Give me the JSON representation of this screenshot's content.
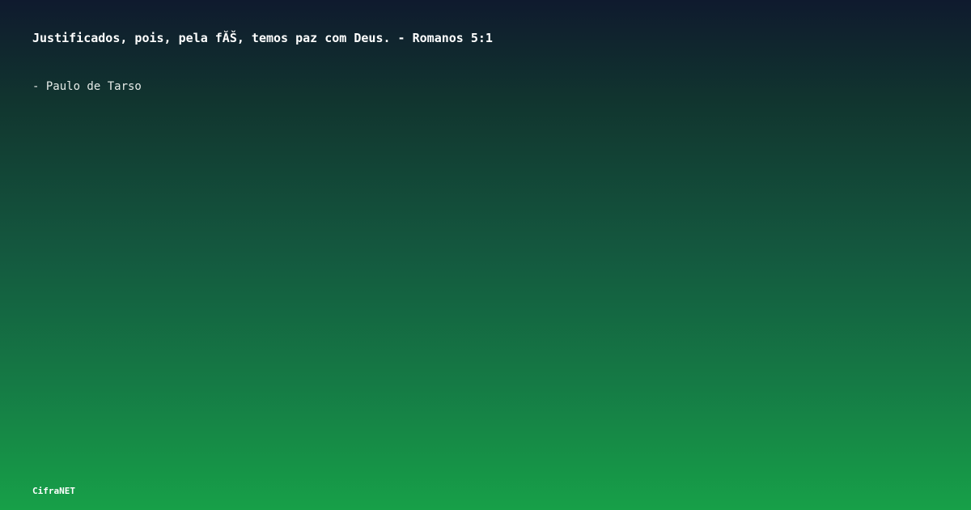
{
  "quote": {
    "text": "Justificados, pois, pela fĂŠ, temos paz com Deus. - Romanos 5:1"
  },
  "author": {
    "text": "- Paulo de Tarso"
  },
  "brand": {
    "name": "CifraNET"
  },
  "colors": {
    "background_top": "#0f1a2e",
    "background_bottom": "#17a048",
    "text": "#ffffff"
  }
}
